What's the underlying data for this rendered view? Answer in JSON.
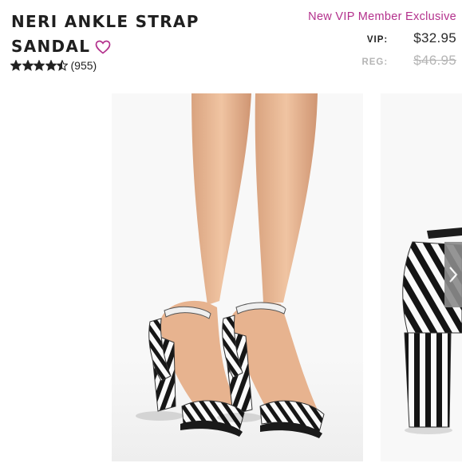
{
  "product": {
    "title_line1": "NERI ANKLE STRAP",
    "title_line2": "SANDAL",
    "review_count": "(955)",
    "rating": 4.5,
    "rating_max": 5
  },
  "pricing": {
    "promo": "New VIP Member Exclusive",
    "vip_label": "VIP:",
    "vip_price": "$32.95",
    "reg_label": "REG:",
    "reg_price": "$46.95"
  },
  "gallery": {
    "next_button": "chevron-right-icon",
    "images": [
      "sandal-model-photo",
      "sandal-closeup-photo"
    ]
  },
  "colors": {
    "accent": "#b3308c",
    "muted": "#b5b5b5",
    "text": "#222222",
    "arrow_bg": "#8b8b8b"
  }
}
